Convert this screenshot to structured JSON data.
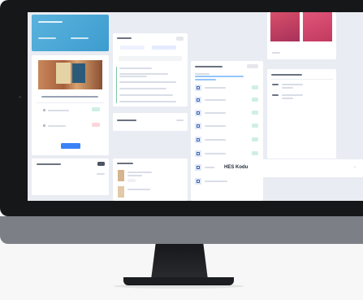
{
  "hes_panel": {
    "title": "HES Kodu"
  },
  "colors": {
    "screen_bg": "#e9ecf2",
    "accent_blue": "#3b82f6",
    "mint": "#cfeee6",
    "pink": "#f9d6dc",
    "banner": "#43a6d6"
  }
}
